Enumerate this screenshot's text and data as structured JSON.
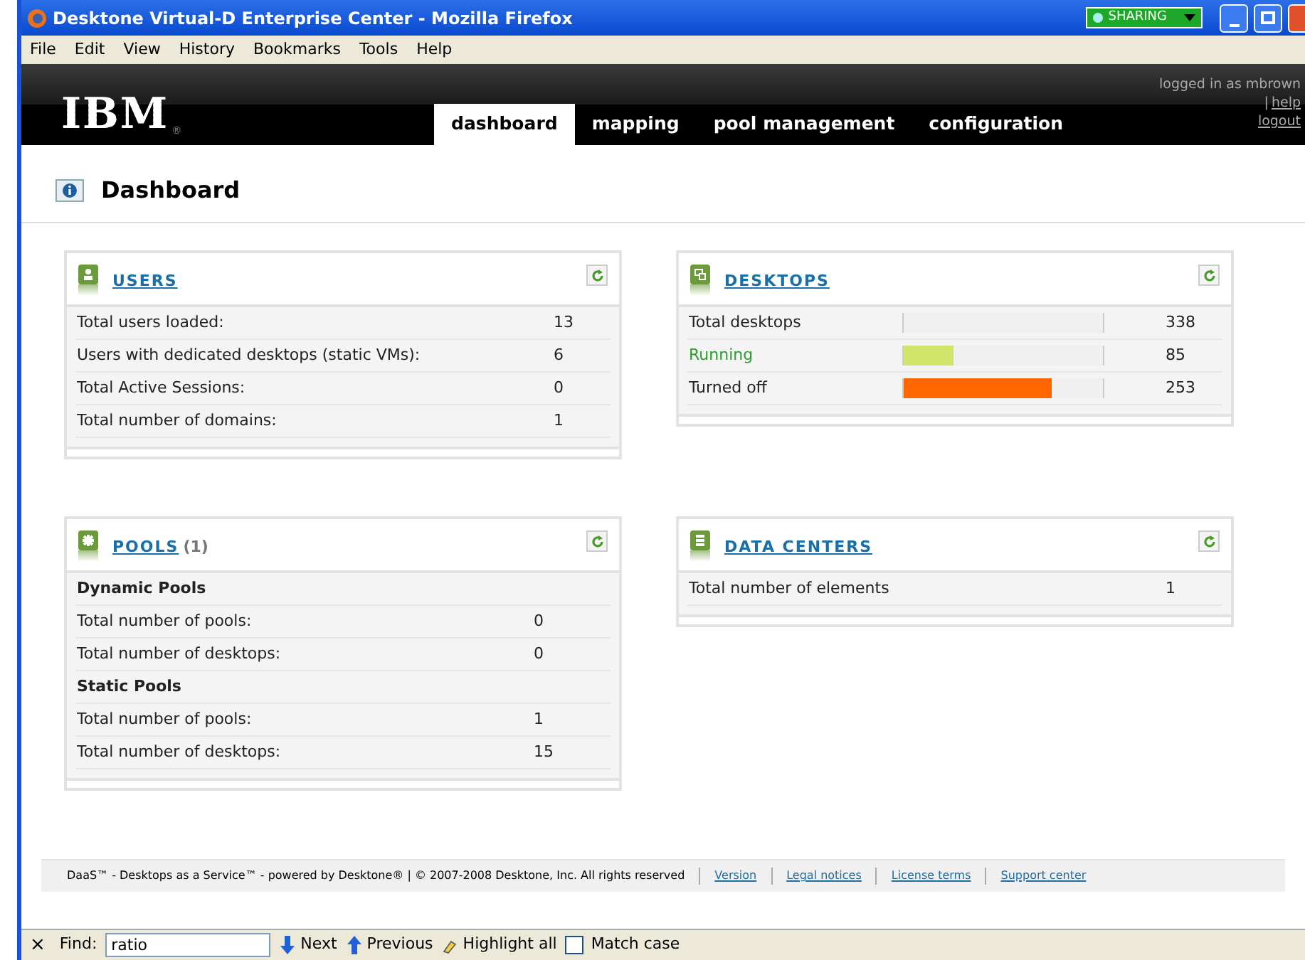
{
  "window": {
    "title": "Desktone Virtual-D Enterprise Center - Mozilla Firefox",
    "sharing": "SHARING"
  },
  "menu": [
    "File",
    "Edit",
    "View",
    "History",
    "Bookmarks",
    "Tools",
    "Help"
  ],
  "header": {
    "logo": "IBM",
    "registered": "®",
    "user": "logged in as mbrown",
    "links": [
      "help",
      "logout"
    ],
    "separator": "|"
  },
  "tabs": [
    {
      "label": "dashboard",
      "selected": true
    },
    {
      "label": "mapping",
      "selected": false
    },
    {
      "label": "pool management",
      "selected": false
    },
    {
      "label": "configuration",
      "selected": false
    }
  ],
  "page_title": "Dashboard",
  "users": {
    "title": "USERS",
    "rows": [
      {
        "label": "Total users loaded:",
        "value": "13"
      },
      {
        "label": "Users with dedicated desktops (static VMs):",
        "value": "6"
      },
      {
        "label": "Total Active Sessions:",
        "value": "0"
      },
      {
        "label": "Total number of domains:",
        "value": "1"
      }
    ]
  },
  "desktops": {
    "title": "DESKTOPS",
    "rows": [
      {
        "label": "Total desktops",
        "value": "338",
        "highlighted": false
      },
      {
        "label": "Running",
        "value": "85",
        "highlighted": true,
        "level": 0.25,
        "color": "#d0e46a"
      },
      {
        "label": "Turned off",
        "value": "253",
        "highlighted": false,
        "level": 0.74,
        "color": "#ff6600"
      }
    ]
  },
  "pools": {
    "title": "POOLS",
    "count": "(1)",
    "rows": [
      {
        "kind": "heading",
        "label": "Dynamic Pools"
      },
      {
        "kind": "row",
        "label": "Total number of pools:",
        "value": "0"
      },
      {
        "kind": "row",
        "label": "Total number of desktops:",
        "value": "0"
      },
      {
        "kind": "heading",
        "label": "Static Pools"
      },
      {
        "kind": "row",
        "label": "Total number of pools:",
        "value": "1"
      },
      {
        "kind": "row",
        "label": "Total number of desktops:",
        "value": "15"
      }
    ]
  },
  "data_centers": {
    "title": "DATA CENTERS",
    "rows": [
      {
        "label": "Total number of elements",
        "value": "1"
      }
    ]
  },
  "footer": {
    "text": "DaaS™ - Desktops as a Service™ - powered by Desktone® | © 2007-2008 Desktone, Inc. All rights reserved",
    "links": [
      "Version",
      "Legal notices",
      "License terms",
      "Support center"
    ]
  },
  "find_bar": {
    "close": "×",
    "label": "Find:",
    "value": "ratio",
    "next": "Next",
    "previous": "Previous",
    "highlight": "Highlight all",
    "match_case": {
      "label": "Match case",
      "checked": false
    }
  }
}
